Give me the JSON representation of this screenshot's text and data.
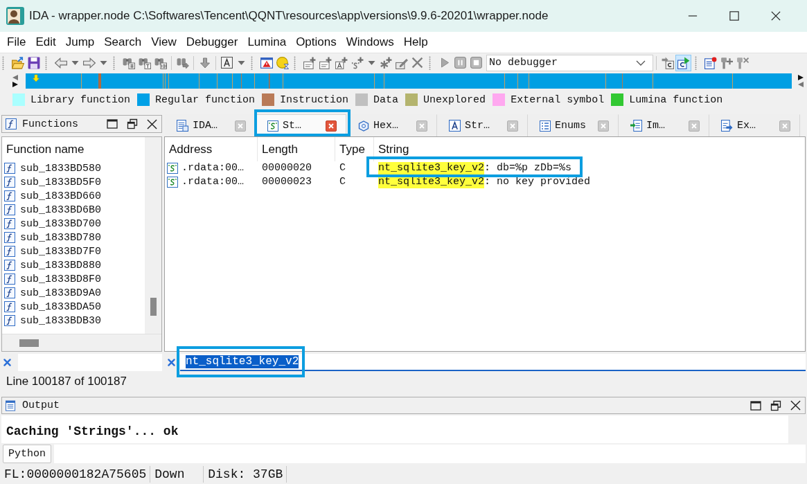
{
  "window": {
    "title": "IDA - wrapper.node C:\\Softwares\\Tencent\\QQNT\\resources\\app\\versions\\9.9.6-20201\\wrapper.node"
  },
  "menu": [
    "File",
    "Edit",
    "Jump",
    "Search",
    "View",
    "Debugger",
    "Lumina",
    "Options",
    "Windows",
    "Help"
  ],
  "toolbar": {
    "debugger_select": "No debugger",
    "debugger_buttons": [
      {
        "pressed": false
      },
      {
        "pressed": true
      }
    ]
  },
  "legend": [
    {
      "label": "Library function",
      "color": "#aaffff"
    },
    {
      "label": "Regular function",
      "color": "#00a0e6"
    },
    {
      "label": "Instruction",
      "color": "#b97a57"
    },
    {
      "label": "Data",
      "color": "#c0c0c0"
    },
    {
      "label": "Unexplored",
      "color": "#b4b46e"
    },
    {
      "label": "External symbol",
      "color": "#ffa8f0"
    },
    {
      "label": "Lumina function",
      "color": "#32c832"
    }
  ],
  "functions_panel": {
    "title": "Functions",
    "column": "Function name",
    "rows": [
      "sub_1833BD580",
      "sub_1833BD5F0",
      "sub_1833BD660",
      "sub_1833BD6B0",
      "sub_1833BD700",
      "sub_1833BD780",
      "sub_1833BD7F0",
      "sub_1833BD880",
      "sub_1833BD8F0",
      "sub_1833BD9A0",
      "sub_1833BDA50",
      "sub_1833BDB30"
    ]
  },
  "line_info": "Line 100187 of 100187",
  "tabs": [
    {
      "label": "IDA…",
      "selected": false,
      "annotated": false
    },
    {
      "label": "St…",
      "selected": true,
      "annotated": true
    },
    {
      "label": "Hex…",
      "selected": false,
      "annotated": false
    },
    {
      "label": "Str…",
      "selected": false,
      "annotated": false
    },
    {
      "label": "Enums",
      "selected": false,
      "annotated": false
    },
    {
      "label": "Im…",
      "selected": false,
      "annotated": false
    },
    {
      "label": "Ex…",
      "selected": false,
      "annotated": false
    }
  ],
  "strings_table": {
    "columns": [
      "Address",
      "Length",
      "Type",
      "String"
    ],
    "rows": [
      {
        "address": ".rdata:00…",
        "length": "00000020",
        "type": "C",
        "match": "nt_sqlite3_key_v2",
        "rest": ": db=%p zDb=%s",
        "annotated": true
      },
      {
        "address": ".rdata:00…",
        "length": "00000023",
        "type": "C",
        "match": "nt_sqlite3_key_v2",
        "rest": ": no key provided",
        "annotated": false
      }
    ]
  },
  "strings_filter": {
    "value": "nt_sqlite3_key_v2",
    "selected": true,
    "annotated": true
  },
  "output_panel": {
    "title": "Output",
    "lines": [
      "Caching 'Strings'... ok"
    ],
    "python_button": "Python"
  },
  "status_bar": [
    "FL:0000000182A75605",
    "Down",
    "Disk: 37GB"
  ]
}
